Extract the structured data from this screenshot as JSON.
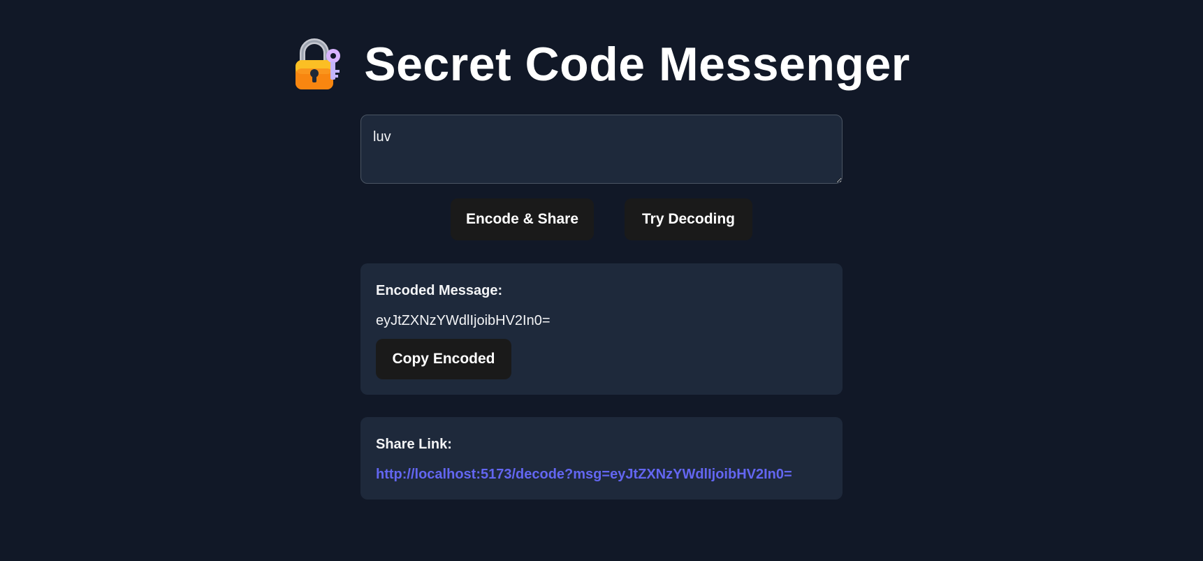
{
  "header": {
    "title": "Secret Code Messenger",
    "icon": "lock-with-key-icon"
  },
  "composer": {
    "message_value": "luv"
  },
  "actions": {
    "encode_label": "Encode & Share",
    "decode_label": "Try Decoding"
  },
  "encoded_card": {
    "label": "Encoded Message:",
    "value": "eyJtZXNzYWdlIjoibHV2In0=",
    "copy_label": "Copy Encoded"
  },
  "share_card": {
    "label": "Share Link:",
    "link": "http://localhost:5173/decode?msg=eyJtZXNzYWdlIjoibHV2In0="
  },
  "colors": {
    "background": "#111827",
    "card": "#1e293b",
    "button": "#1a1a1a",
    "link": "#6366f1"
  }
}
